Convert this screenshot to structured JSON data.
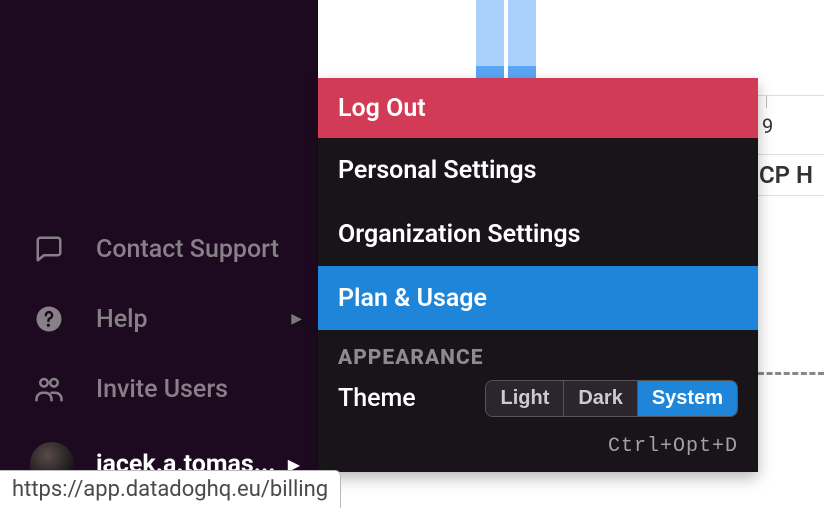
{
  "sidebar": {
    "items": [
      {
        "label": "Contact Support"
      },
      {
        "label": "Help"
      },
      {
        "label": "Invite Users"
      }
    ],
    "user": {
      "display_name": "jacek.a.tomas..."
    }
  },
  "popover": {
    "logout_label": "Log Out",
    "personal_settings_label": "Personal Settings",
    "organization_settings_label": "Organization Settings",
    "plan_usage_label": "Plan & Usage",
    "appearance_section": "APPEARANCE",
    "theme_label": "Theme",
    "theme_options": {
      "light": "Light",
      "dark": "Dark",
      "system": "System"
    },
    "shortcut": "Ctrl+Opt+D"
  },
  "chart": {
    "x_label_right": "9",
    "legend_fragment": "GCP H"
  },
  "status_bar": {
    "url": "https://app.datadoghq.eu/billing"
  }
}
